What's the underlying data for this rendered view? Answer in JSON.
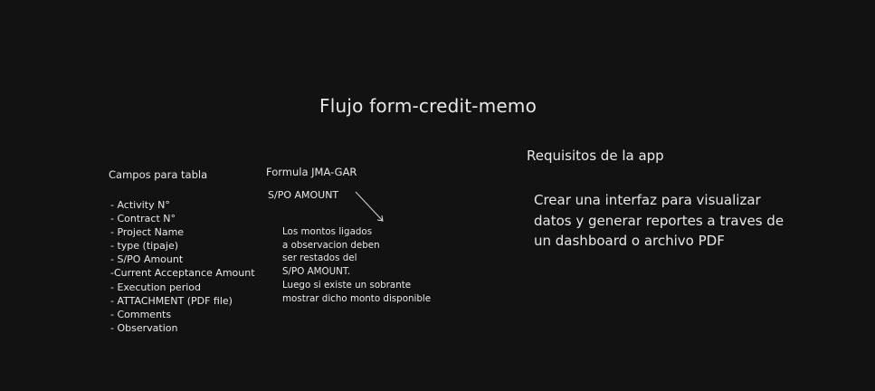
{
  "title": "Flujo form-credit-memo",
  "fields": {
    "heading": "Campos para tabla",
    "items": [
      "- Activity N°",
      "- Contract N°",
      "- Project Name",
      "- type (tipaje)",
      "- S/PO Amount",
      "-Current Acceptance Amount",
      "- Execution period",
      "- ATTACHMENT (PDF file)",
      "- Comments",
      "- Observation"
    ]
  },
  "formula": {
    "heading": "Formula JMA-GAR",
    "label": "S/PO AMOUNT",
    "note_lines": [
      "Los montos ligados",
      "a observacion deben",
      "ser restados del",
      "S/PO AMOUNT.",
      "Luego si existe un sobrante",
      "mostrar dicho monto disponible"
    ]
  },
  "requirements": {
    "heading": "Requisitos de la app",
    "lines": [
      "Crear una interfaz para visualizar",
      "datos y generar reportes a traves de",
      "un dashboard o archivo PDF"
    ]
  },
  "colors": {
    "background": "#121212",
    "text": "#e8e8e8"
  }
}
